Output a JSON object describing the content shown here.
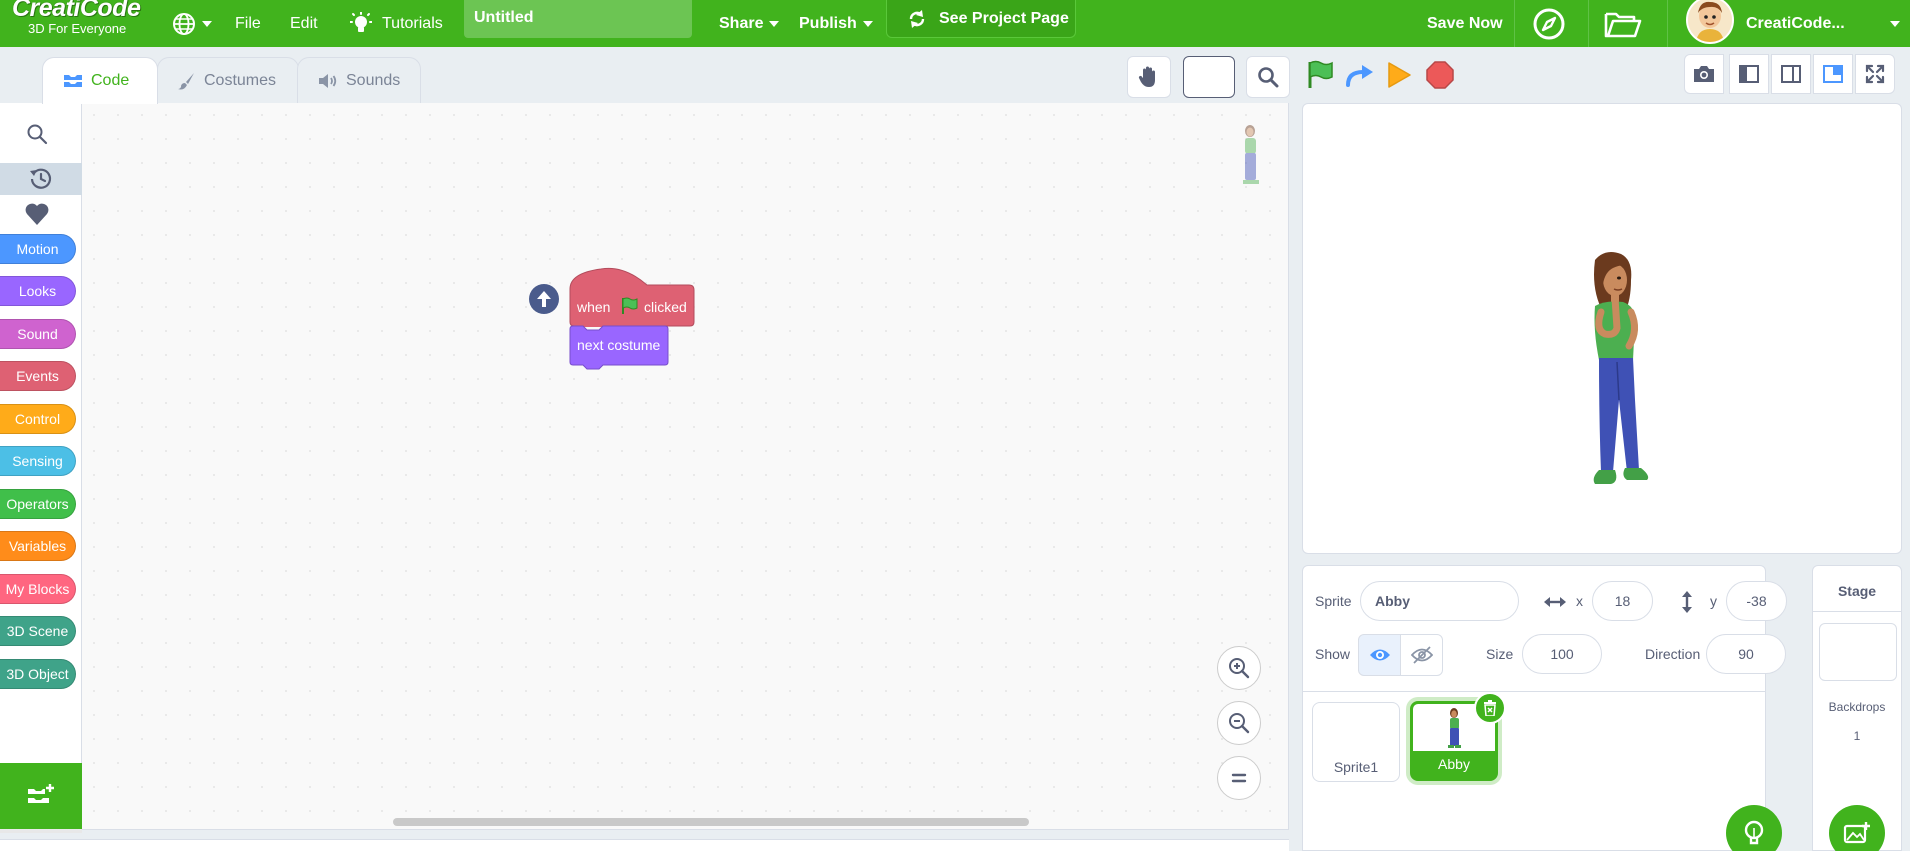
{
  "menubar": {
    "logo_title": "CreatiCode",
    "logo_subtitle": "3D For Everyone",
    "file": "File",
    "edit": "Edit",
    "tutorials": "Tutorials",
    "project_title": "Untitled",
    "share": "Share",
    "publish": "Publish",
    "see_project_page": "See Project Page",
    "save_now": "Save Now",
    "username": "CreatiCode..."
  },
  "tabs": [
    {
      "label": "Code",
      "icon": "code-icon",
      "active": true
    },
    {
      "label": "Costumes",
      "icon": "brush-icon",
      "active": false
    },
    {
      "label": "Sounds",
      "icon": "speaker-icon",
      "active": false
    }
  ],
  "categories": [
    {
      "label": "Motion",
      "color": "#4c97ff"
    },
    {
      "label": "Looks",
      "color": "#9966ff"
    },
    {
      "label": "Sound",
      "color": "#cf63cf"
    },
    {
      "label": "Events",
      "color": "#de6173"
    },
    {
      "label": "Control",
      "color": "#ffab19"
    },
    {
      "label": "Sensing",
      "color": "#4cbfe6"
    },
    {
      "label": "Operators",
      "color": "#40bf4a"
    },
    {
      "label": "Variables",
      "color": "#ff8c1a"
    },
    {
      "label": "My Blocks",
      "color": "#ff6680"
    },
    {
      "label": "3D Scene",
      "color": "#3fa389"
    },
    {
      "label": "3D Object",
      "color": "#3fa389"
    }
  ],
  "blocks": {
    "hat_when": "when",
    "hat_clicked": "clicked",
    "next_costume": "next costume",
    "events_color": "#de6173",
    "looks_color": "#9966ff"
  },
  "sprite_info": {
    "sprite_label": "Sprite",
    "sprite_name": "Abby",
    "x_label": "x",
    "x_value": "18",
    "y_label": "y",
    "y_value": "-38",
    "show_label": "Show",
    "size_label": "Size",
    "size_value": "100",
    "direction_label": "Direction",
    "direction_value": "90"
  },
  "sprites": [
    {
      "name": "Sprite1",
      "selected": false
    },
    {
      "name": "Abby",
      "selected": true
    }
  ],
  "stage_panel": {
    "title": "Stage",
    "backdrops_label": "Backdrops",
    "backdrops_count": "1"
  },
  "colors": {
    "brand_green": "#41b31d",
    "accent_blue": "#4c97ff"
  }
}
